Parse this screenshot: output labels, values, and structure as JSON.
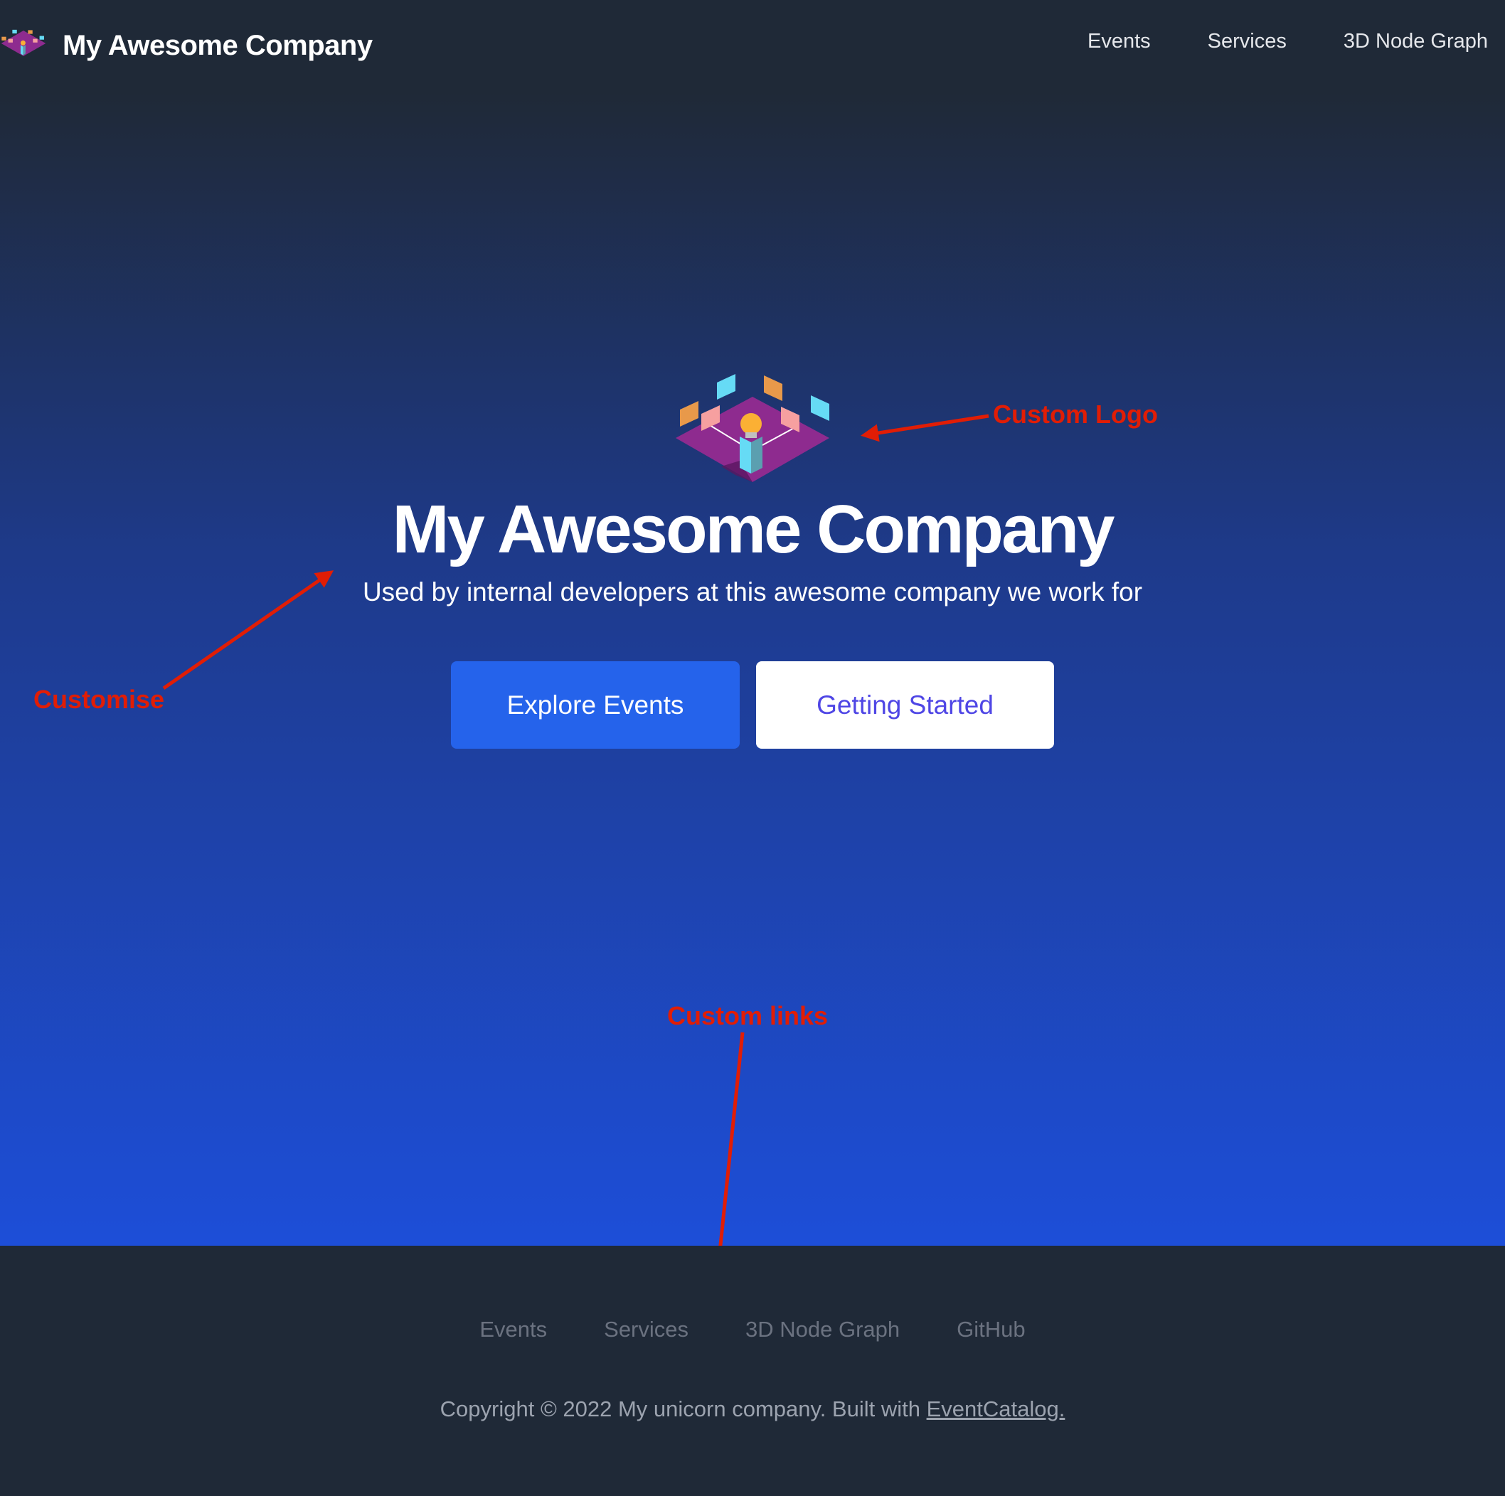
{
  "header": {
    "brand_name": "My Awesome Company",
    "logo_icon": "isometric-lightbulb-logo",
    "nav_links": [
      {
        "label": "Events"
      },
      {
        "label": "Services"
      },
      {
        "label": "3D Node Graph"
      }
    ]
  },
  "hero": {
    "logo_icon": "isometric-lightbulb-logo",
    "title": "My Awesome Company",
    "subtitle": "Used by internal developers at this awesome company we work for",
    "primary_button": "Explore Events",
    "secondary_button": "Getting Started"
  },
  "annotations": {
    "custom_logo": "Custom Logo",
    "customise": "Customise",
    "custom_links": "Custom links",
    "color": "#e11d05"
  },
  "footer": {
    "links": [
      {
        "label": "Events"
      },
      {
        "label": "Services"
      },
      {
        "label": "3D Node Graph"
      },
      {
        "label": "GitHub"
      }
    ],
    "copyright_text": "Copyright © 2022 My unicorn company. Built with ",
    "copyright_link": "EventCatalog."
  },
  "colors": {
    "nav_bg": "#1f2937",
    "hero_gradient_top": "#1f2937",
    "hero_gradient_bottom": "#1d4ed8",
    "primary_button": "#2563eb",
    "secondary_button_text": "#4f46e5"
  }
}
